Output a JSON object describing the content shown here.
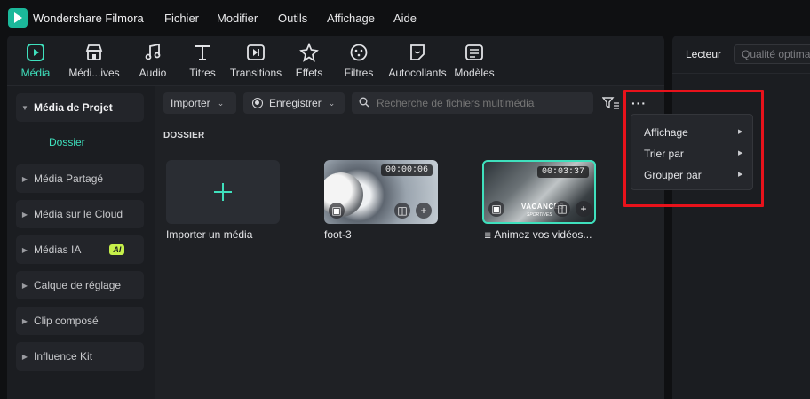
{
  "app": {
    "name": "Wondershare Filmora"
  },
  "menubar": [
    "Fichier",
    "Modifier",
    "Outils",
    "Affichage",
    "Aide"
  ],
  "toolbar": [
    {
      "label": "Média",
      "icon": "media-icon",
      "active": true
    },
    {
      "label": "Médi...ives",
      "icon": "store-icon",
      "active": false
    },
    {
      "label": "Audio",
      "icon": "music-note-icon",
      "active": false
    },
    {
      "label": "Titres",
      "icon": "text-icon",
      "active": false
    },
    {
      "label": "Transitions",
      "icon": "transition-icon",
      "active": false
    },
    {
      "label": "Effets",
      "icon": "effects-icon",
      "active": false
    },
    {
      "label": "Filtres",
      "icon": "filter-icon",
      "active": false
    },
    {
      "label": "Autocollants",
      "icon": "sticker-icon",
      "active": false
    },
    {
      "label": "Modèles",
      "icon": "template-icon",
      "active": false
    }
  ],
  "sidebar": {
    "items": [
      {
        "label": "Média de Projet"
      },
      {
        "label": "Média Partagé"
      },
      {
        "label": "Média sur le Cloud"
      },
      {
        "label": "Médias IA",
        "badge": "AI"
      },
      {
        "label": "Calque de réglage"
      },
      {
        "label": "Clip composé"
      },
      {
        "label": "Influence Kit"
      }
    ],
    "sub_item": "Dossier"
  },
  "content": {
    "import_label": "Importer",
    "record_label": "Enregistrer",
    "search_placeholder": "Recherche de fichiers multimédia",
    "section_label": "DOSSIER",
    "tiles": [
      {
        "label": "Importer un média"
      },
      {
        "label": "foot-3",
        "duration": "00:00:06"
      },
      {
        "label": "Animez vos vidéos...",
        "duration": "00:03:37",
        "overlay_title": "VACANCES",
        "overlay_subtitle": "SPORTIVES"
      }
    ]
  },
  "dropdown": {
    "more_label": "···",
    "items": [
      "Affichage",
      "Trier par",
      "Grouper par"
    ]
  },
  "right_panel": {
    "tab": "Lecteur",
    "quality": "Qualité optimale"
  },
  "colors": {
    "accent": "#3fe0bd",
    "highlight": "#e8121b",
    "ai_badge": "#c6f04a"
  }
}
